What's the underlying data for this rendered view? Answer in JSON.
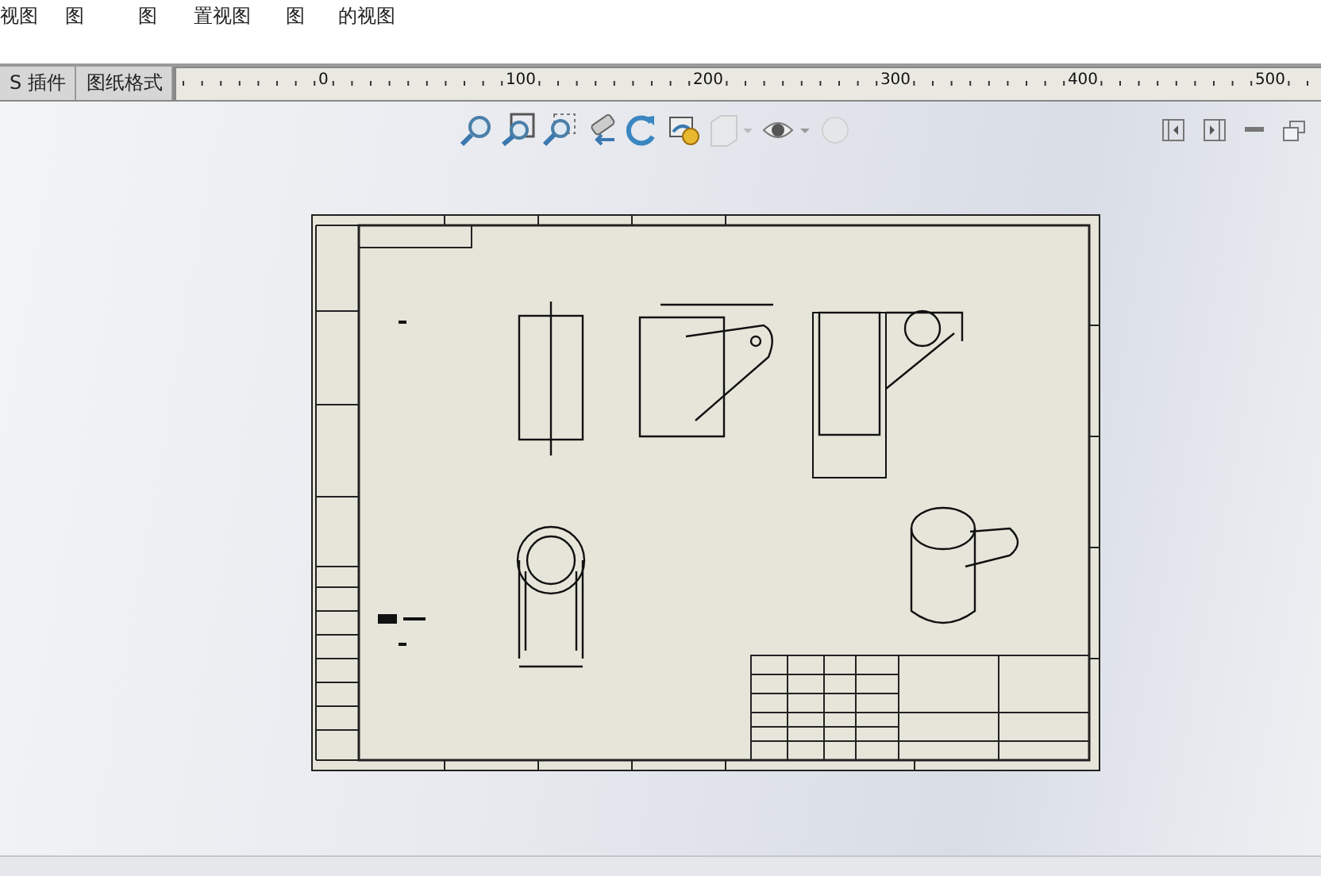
{
  "ribbon": {
    "labels": [
      "视图",
      "图",
      "图",
      "置视图",
      "图",
      "的视图"
    ]
  },
  "tabs": [
    {
      "label": "S 插件",
      "selected": false
    },
    {
      "label": "图纸格式",
      "selected": false
    }
  ],
  "ruler": {
    "labels": [
      "0",
      "100",
      "200",
      "300",
      "400",
      "500"
    ]
  }
}
